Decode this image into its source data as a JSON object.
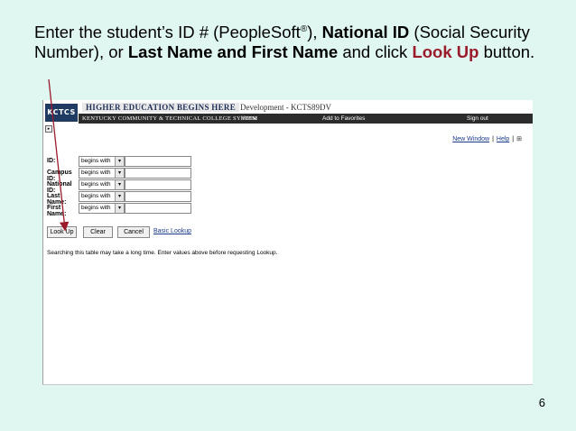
{
  "instructions": {
    "part1": "Enter the student’s ID # (PeopleSoft",
    "reg": "®",
    "part2": "), ",
    "national_id": "National ID",
    "part3": " (Social Security Number), or ",
    "name": "Last Name and First Name",
    "part4": " and click ",
    "look_up": "Look Up",
    "part5": " button."
  },
  "slide_number": "6",
  "screenshot": {
    "logo_text": "KCTCS",
    "slogan": "HIGHER EDUCATION BEGINS HERE",
    "environment": "Development - KCTS89DV",
    "college_name": "KENTUCKY COMMUNITY & TECHNICAL COLLEGE SYSTEM",
    "nav": {
      "home": "Home",
      "favorites": "Add to Favorites",
      "signout": "Sign out"
    },
    "top_links": {
      "new_window": "New Window",
      "help": "Help"
    },
    "fields": [
      {
        "label": "ID:",
        "operator": "begins with",
        "value": ""
      },
      {
        "label": "Campus ID:",
        "operator": "begins with",
        "value": ""
      },
      {
        "label": "National ID:",
        "operator": "begins with",
        "value": ""
      },
      {
        "label": "Last Name:",
        "operator": "begins with",
        "value": ""
      },
      {
        "label": "First Name:",
        "operator": "begins with",
        "value": ""
      }
    ],
    "buttons": {
      "lookup": "Look Up",
      "clear": "Clear",
      "cancel": "Cancel",
      "basic_lookup": "Basic Lookup"
    },
    "note": "Searching this table may take a long time. Enter values above before requesting Lookup."
  }
}
